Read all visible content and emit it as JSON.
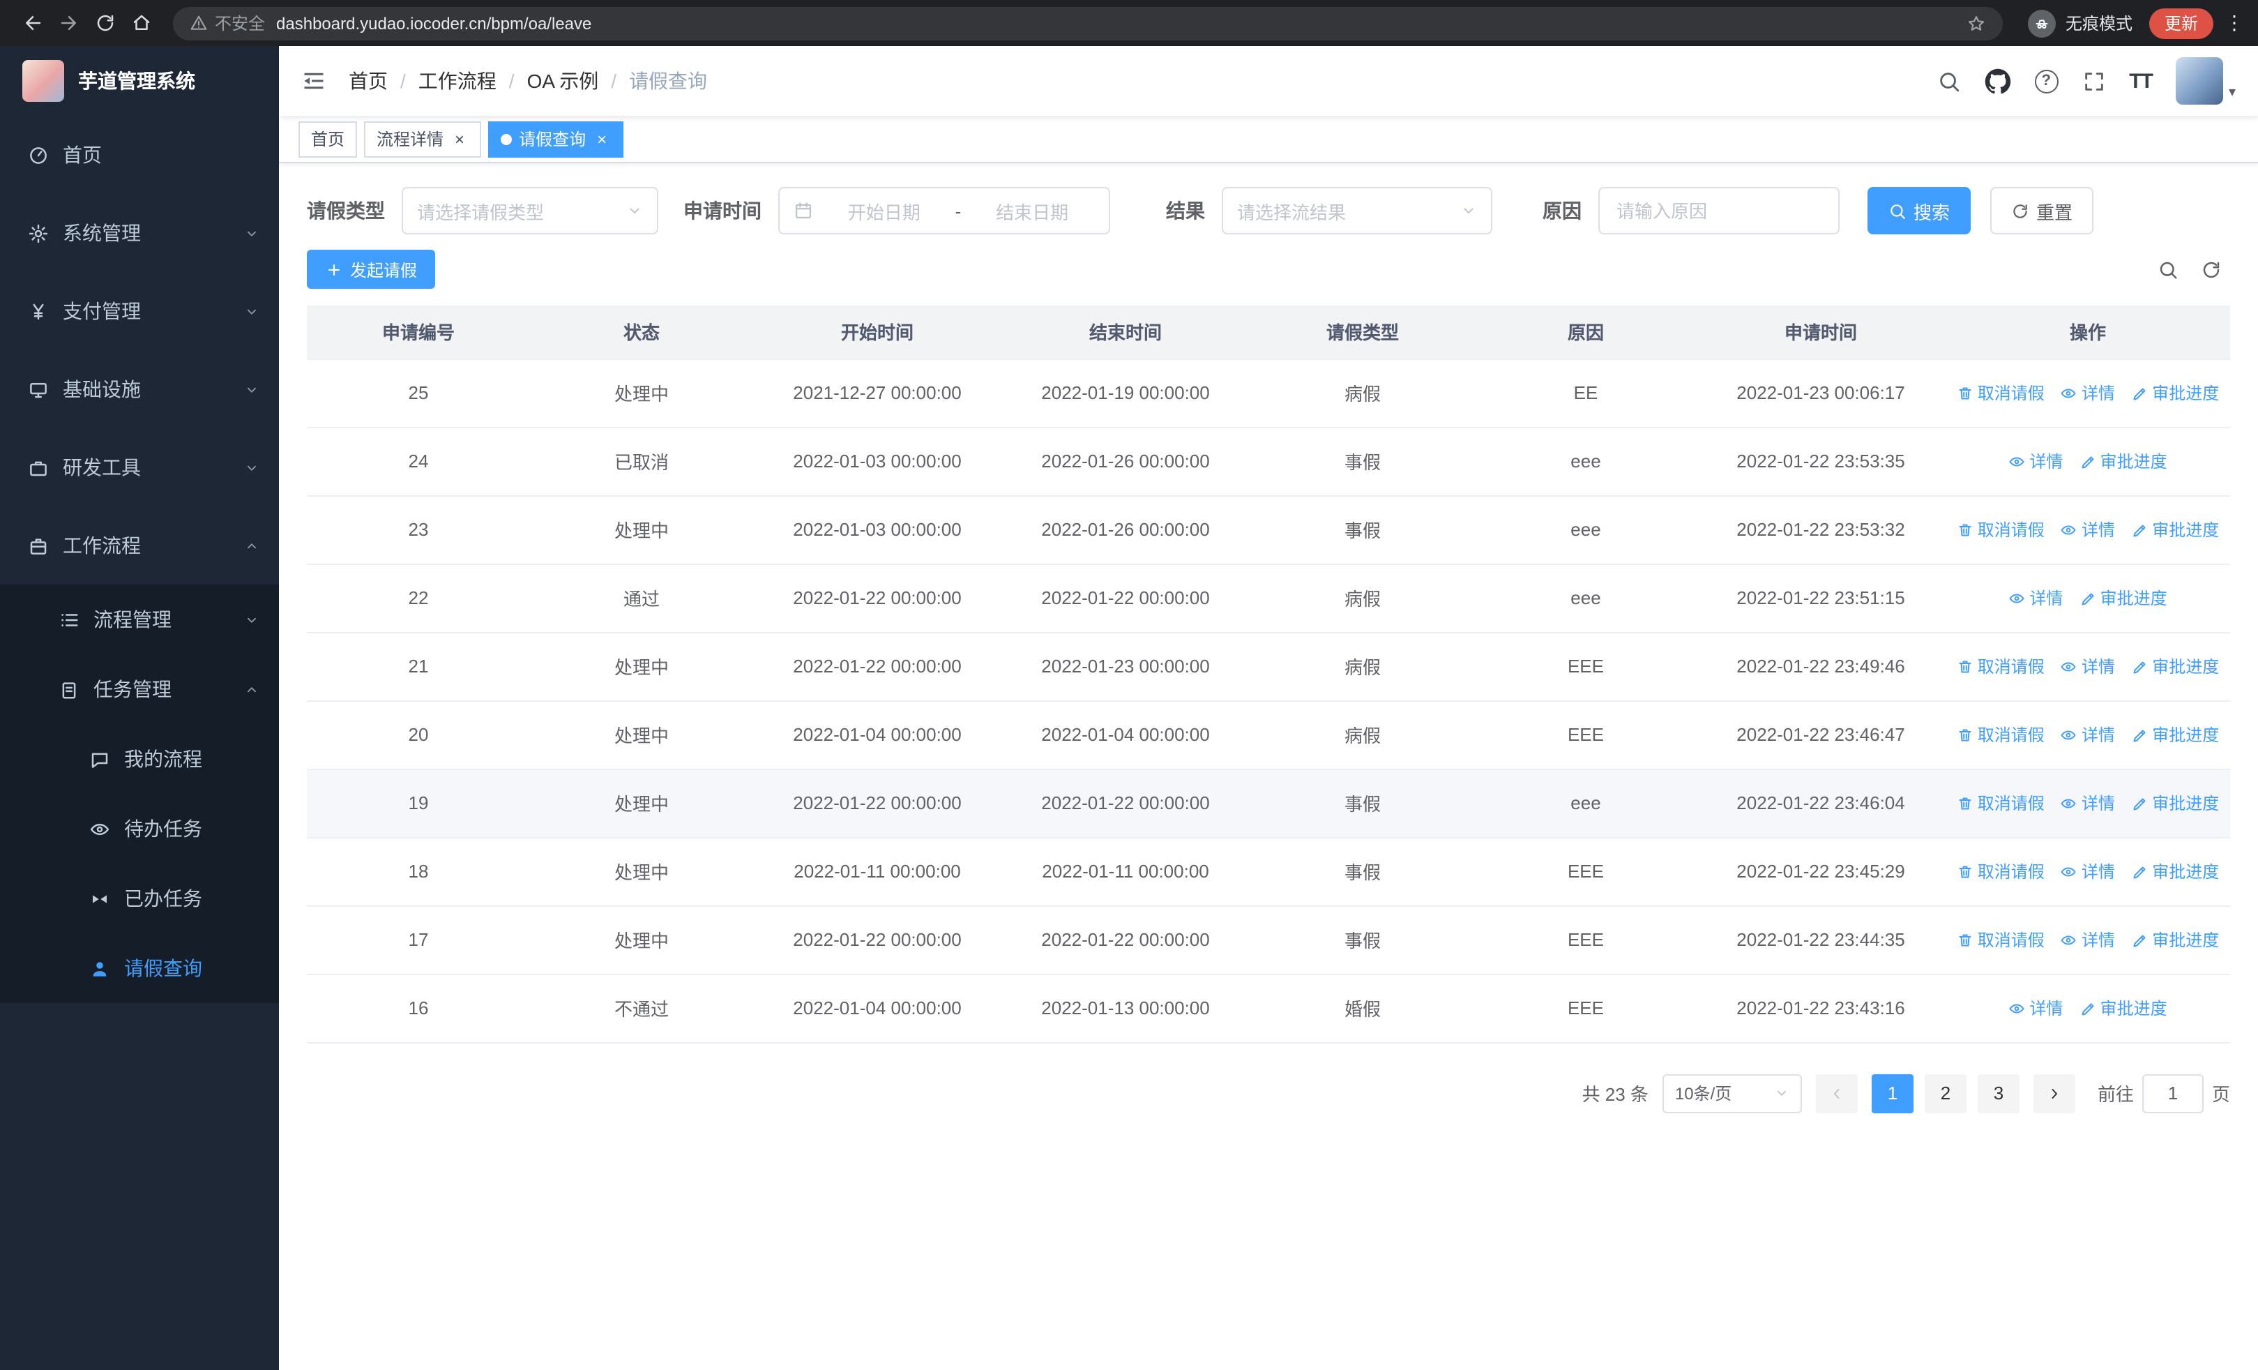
{
  "browser": {
    "security_label": "不安全",
    "url": "dashboard.yudao.iocoder.cn/bpm/oa/leave",
    "incognito_label": "无痕模式",
    "update_label": "更新"
  },
  "icons": {
    "close": "×",
    "kebab": "⋮",
    "caret_down": "▾",
    "question": "?",
    "font_size": "TT"
  },
  "sidebar": {
    "app_title": "芋道管理系统",
    "menu": [
      {
        "label": "首页"
      },
      {
        "label": "系统管理"
      },
      {
        "label": "支付管理"
      },
      {
        "label": "基础设施"
      },
      {
        "label": "研发工具"
      },
      {
        "label": "工作流程"
      }
    ],
    "submenu": {
      "process_label": "流程管理",
      "task_label": "任务管理",
      "task_children": [
        {
          "label": "我的流程"
        },
        {
          "label": "待办任务"
        },
        {
          "label": "已办任务"
        },
        {
          "label": "请假查询"
        }
      ]
    }
  },
  "header": {
    "breadcrumb": [
      "首页",
      "工作流程",
      "OA 示例",
      "请假查询"
    ],
    "breadcrumb_separator": "/"
  },
  "tabs": [
    {
      "label": "首页",
      "closable": false,
      "active": false
    },
    {
      "label": "流程详情",
      "closable": true,
      "active": false
    },
    {
      "label": "请假查询",
      "closable": true,
      "active": true
    }
  ],
  "filters": {
    "type_label": "请假类型",
    "type_placeholder": "请选择请假类型",
    "time_label": "申请时间",
    "start_placeholder": "开始日期",
    "range_separator": "-",
    "end_placeholder": "结束日期",
    "result_label": "结果",
    "result_placeholder": "请选择流结果",
    "reason_label": "原因",
    "reason_placeholder": "请输入原因",
    "search_label": "搜索",
    "reset_label": "重置"
  },
  "toolbar": {
    "create_label": "发起请假"
  },
  "table": {
    "headers": [
      "申请编号",
      "状态",
      "开始时间",
      "结束时间",
      "请假类型",
      "原因",
      "申请时间",
      "操作"
    ],
    "actions": {
      "cancel": "取消请假",
      "detail": "详情",
      "progress": "审批进度"
    },
    "rows": [
      {
        "id": "25",
        "status": "处理中",
        "start": "2021-12-27 00:00:00",
        "end": "2022-01-19 00:00:00",
        "type": "病假",
        "reason": "EE",
        "apply_time": "2022-01-23 00:06:17",
        "can_cancel": true,
        "highlighted": false
      },
      {
        "id": "24",
        "status": "已取消",
        "start": "2022-01-03 00:00:00",
        "end": "2022-01-26 00:00:00",
        "type": "事假",
        "reason": "eee",
        "apply_time": "2022-01-22 23:53:35",
        "can_cancel": false,
        "highlighted": false
      },
      {
        "id": "23",
        "status": "处理中",
        "start": "2022-01-03 00:00:00",
        "end": "2022-01-26 00:00:00",
        "type": "事假",
        "reason": "eee",
        "apply_time": "2022-01-22 23:53:32",
        "can_cancel": true,
        "highlighted": false
      },
      {
        "id": "22",
        "status": "通过",
        "start": "2022-01-22 00:00:00",
        "end": "2022-01-22 00:00:00",
        "type": "病假",
        "reason": "eee",
        "apply_time": "2022-01-22 23:51:15",
        "can_cancel": false,
        "highlighted": false
      },
      {
        "id": "21",
        "status": "处理中",
        "start": "2022-01-22 00:00:00",
        "end": "2022-01-23 00:00:00",
        "type": "病假",
        "reason": "EEE",
        "apply_time": "2022-01-22 23:49:46",
        "can_cancel": true,
        "highlighted": false
      },
      {
        "id": "20",
        "status": "处理中",
        "start": "2022-01-04 00:00:00",
        "end": "2022-01-04 00:00:00",
        "type": "病假",
        "reason": "EEE",
        "apply_time": "2022-01-22 23:46:47",
        "can_cancel": true,
        "highlighted": false
      },
      {
        "id": "19",
        "status": "处理中",
        "start": "2022-01-22 00:00:00",
        "end": "2022-01-22 00:00:00",
        "type": "事假",
        "reason": "eee",
        "apply_time": "2022-01-22 23:46:04",
        "can_cancel": true,
        "highlighted": true
      },
      {
        "id": "18",
        "status": "处理中",
        "start": "2022-01-11 00:00:00",
        "end": "2022-01-11 00:00:00",
        "type": "事假",
        "reason": "EEE",
        "apply_time": "2022-01-22 23:45:29",
        "can_cancel": true,
        "highlighted": false
      },
      {
        "id": "17",
        "status": "处理中",
        "start": "2022-01-22 00:00:00",
        "end": "2022-01-22 00:00:00",
        "type": "事假",
        "reason": "EEE",
        "apply_time": "2022-01-22 23:44:35",
        "can_cancel": true,
        "highlighted": false
      },
      {
        "id": "16",
        "status": "不通过",
        "start": "2022-01-04 00:00:00",
        "end": "2022-01-13 00:00:00",
        "type": "婚假",
        "reason": "EEE",
        "apply_time": "2022-01-22 23:43:16",
        "can_cancel": false,
        "highlighted": false
      }
    ]
  },
  "pagination": {
    "total_text": "共 23 条",
    "page_size_label": "10条/页",
    "pages": [
      "1",
      "2",
      "3"
    ],
    "active_page": "1",
    "goto_label": "前往",
    "goto_value": "1",
    "page_unit": "页"
  },
  "colors": {
    "primary": "#409eff",
    "chrome_bg": "#202124",
    "sidebar_bg": "#1d2735",
    "sidebar_submenu_bg": "#151d28",
    "update_pill": "#de5145"
  }
}
